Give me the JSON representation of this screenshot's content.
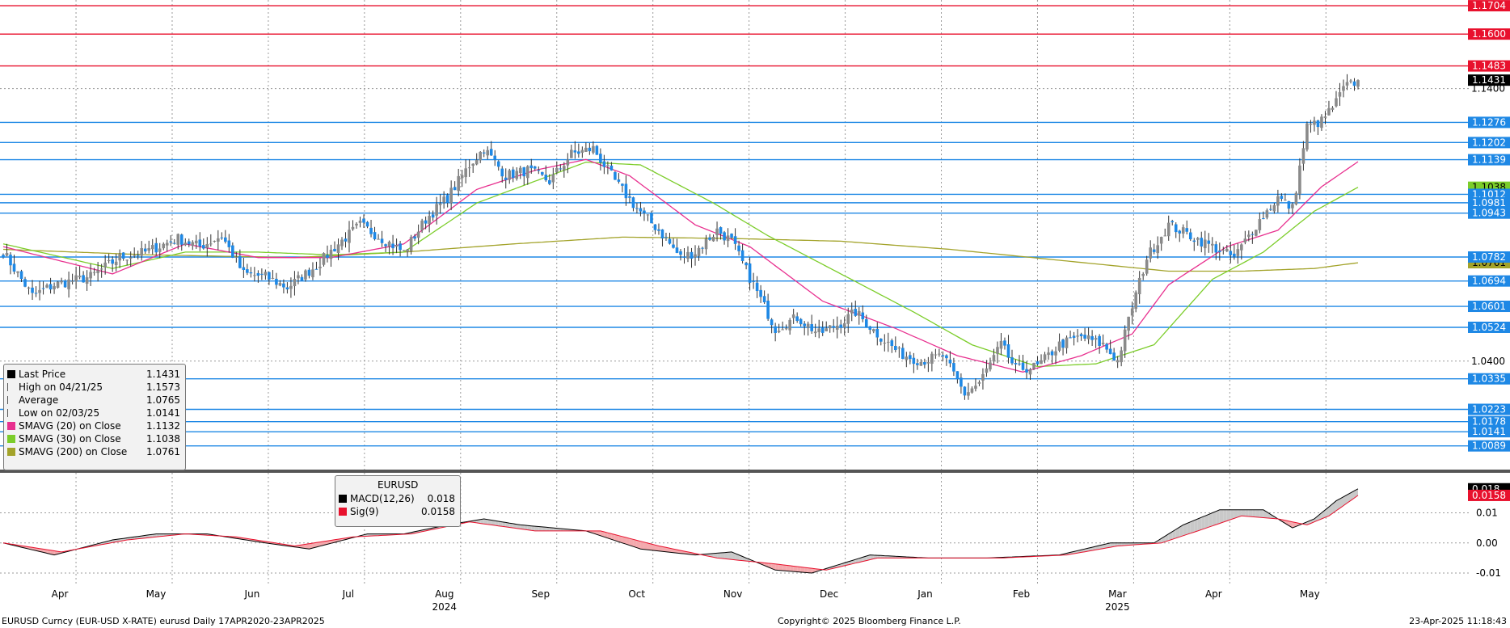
{
  "chart_data": [
    {
      "type": "candlestick",
      "id": "price",
      "ylim": [
        1.0005,
        1.1725
      ],
      "y_ticks": [
        1.04,
        1.14
      ],
      "x_months": [
        "Apr",
        "May",
        "Jun",
        "Jul",
        "Aug",
        "Sep",
        "Oct",
        "Nov",
        "Dec",
        "Jan",
        "Feb",
        "Mar",
        "Apr",
        "May"
      ],
      "year_labels": [
        "2024",
        "2025"
      ],
      "h_lines_red": [
        1.1704,
        1.16,
        1.1483
      ],
      "h_lines_blue": [
        1.1276,
        1.1202,
        1.1139,
        1.1012,
        1.0981,
        1.0943,
        1.0782,
        1.0694,
        1.0601,
        1.0524,
        1.0335,
        1.0223,
        1.0178,
        1.0141,
        1.0089
      ],
      "price_labels": [
        {
          "text": "1.1704",
          "value": 1.1704,
          "bg": "#e8112d"
        },
        {
          "text": "1.1600",
          "value": 1.16,
          "bg": "#e8112d"
        },
        {
          "text": "1.1483",
          "value": 1.1483,
          "bg": "#e8112d"
        },
        {
          "text": "1.1431",
          "value": 1.1431,
          "bg": "#000000"
        },
        {
          "text": "1.1276",
          "value": 1.1276,
          "bg": "#1e88e5"
        },
        {
          "text": "1.1202",
          "value": 1.1202,
          "bg": "#1e88e5"
        },
        {
          "text": "1.1139",
          "value": 1.1139,
          "bg": "#1e88e5"
        },
        {
          "text": "1.1038",
          "value": 1.1038,
          "bg": "#7ccd2a"
        },
        {
          "text": "1.1012",
          "value": 1.1012,
          "bg": "#1e88e5"
        },
        {
          "text": "1.0981",
          "value": 1.0981,
          "bg": "#1e88e5"
        },
        {
          "text": "1.0943",
          "value": 1.0943,
          "bg": "#1e88e5"
        },
        {
          "text": "1.0761",
          "value": 1.0761,
          "bg": "#a3a32a"
        },
        {
          "text": "1.0782",
          "value": 1.0782,
          "bg": "#1e88e5"
        },
        {
          "text": "1.0694",
          "value": 1.0694,
          "bg": "#1e88e5"
        },
        {
          "text": "1.0601",
          "value": 1.0601,
          "bg": "#1e88e5"
        },
        {
          "text": "1.0524",
          "value": 1.0524,
          "bg": "#1e88e5"
        },
        {
          "text": "1.0335",
          "value": 1.0335,
          "bg": "#1e88e5"
        },
        {
          "text": "1.0223",
          "value": 1.0223,
          "bg": "#1e88e5"
        },
        {
          "text": "1.0178",
          "value": 1.0178,
          "bg": "#1e88e5"
        },
        {
          "text": "1.0141",
          "value": 1.0141,
          "bg": "#1e88e5"
        },
        {
          "text": "1.0089",
          "value": 1.0089,
          "bg": "#1e88e5"
        }
      ],
      "close_anchors": [
        [
          0,
          1.08
        ],
        [
          8,
          1.064
        ],
        [
          14,
          1.068
        ],
        [
          24,
          1.071
        ],
        [
          32,
          1.078
        ],
        [
          39,
          1.08
        ],
        [
          48,
          1.085
        ],
        [
          54,
          1.082
        ],
        [
          60,
          1.086
        ],
        [
          66,
          1.072
        ],
        [
          72,
          1.071
        ],
        [
          78,
          1.067
        ],
        [
          86,
          1.075
        ],
        [
          92,
          1.083
        ],
        [
          98,
          1.09
        ],
        [
          104,
          1.085
        ],
        [
          110,
          1.08
        ],
        [
          116,
          1.092
        ],
        [
          122,
          1.1
        ],
        [
          128,
          1.112
        ],
        [
          132,
          1.118
        ],
        [
          138,
          1.108
        ],
        [
          144,
          1.11
        ],
        [
          150,
          1.106
        ],
        [
          156,
          1.116
        ],
        [
          162,
          1.118
        ],
        [
          168,
          1.106
        ],
        [
          174,
          1.096
        ],
        [
          180,
          1.088
        ],
        [
          186,
          1.078
        ],
        [
          190,
          1.08
        ],
        [
          196,
          1.088
        ],
        [
          200,
          1.084
        ],
        [
          206,
          1.068
        ],
        [
          212,
          1.052
        ],
        [
          218,
          1.056
        ],
        [
          224,
          1.05
        ],
        [
          230,
          1.054
        ],
        [
          234,
          1.058
        ],
        [
          240,
          1.05
        ],
        [
          246,
          1.043
        ],
        [
          252,
          1.04
        ],
        [
          258,
          1.042
        ],
        [
          264,
          1.028
        ],
        [
          268,
          1.032
        ],
        [
          274,
          1.046
        ],
        [
          278,
          1.037
        ],
        [
          284,
          1.038
        ],
        [
          290,
          1.046
        ],
        [
          296,
          1.049
        ],
        [
          302,
          1.046
        ],
        [
          306,
          1.04
        ],
        [
          310,
          1.06
        ],
        [
          314,
          1.078
        ],
        [
          320,
          1.09
        ],
        [
          326,
          1.086
        ],
        [
          332,
          1.082
        ],
        [
          338,
          1.078
        ],
        [
          344,
          1.09
        ],
        [
          350,
          1.1
        ],
        [
          354,
          1.096
        ],
        [
          358,
          1.126
        ],
        [
          362,
          1.128
        ],
        [
          366,
          1.135
        ],
        [
          368,
          1.14
        ],
        [
          372,
          1.143
        ]
      ],
      "sma_20": [
        [
          0,
          1.082
        ],
        [
          30,
          1.072
        ],
        [
          50,
          1.083
        ],
        [
          70,
          1.078
        ],
        [
          90,
          1.078
        ],
        [
          110,
          1.083
        ],
        [
          130,
          1.103
        ],
        [
          146,
          1.11
        ],
        [
          160,
          1.114
        ],
        [
          172,
          1.108
        ],
        [
          190,
          1.09
        ],
        [
          205,
          1.082
        ],
        [
          225,
          1.062
        ],
        [
          245,
          1.052
        ],
        [
          262,
          1.042
        ],
        [
          280,
          1.036
        ],
        [
          296,
          1.042
        ],
        [
          310,
          1.05
        ],
        [
          320,
          1.068
        ],
        [
          336,
          1.082
        ],
        [
          350,
          1.088
        ],
        [
          362,
          1.104
        ],
        [
          372,
          1.1132
        ]
      ],
      "sma_30": [
        [
          0,
          1.083
        ],
        [
          30,
          1.074
        ],
        [
          50,
          1.08
        ],
        [
          70,
          1.08
        ],
        [
          90,
          1.079
        ],
        [
          110,
          1.08
        ],
        [
          130,
          1.098
        ],
        [
          146,
          1.106
        ],
        [
          160,
          1.113
        ],
        [
          175,
          1.112
        ],
        [
          195,
          1.098
        ],
        [
          210,
          1.086
        ],
        [
          230,
          1.072
        ],
        [
          250,
          1.058
        ],
        [
          266,
          1.046
        ],
        [
          284,
          1.038
        ],
        [
          300,
          1.039
        ],
        [
          316,
          1.046
        ],
        [
          332,
          1.07
        ],
        [
          346,
          1.08
        ],
        [
          360,
          1.095
        ],
        [
          372,
          1.1038
        ]
      ],
      "sma_200": [
        [
          0,
          1.081
        ],
        [
          40,
          1.079
        ],
        [
          80,
          1.078
        ],
        [
          110,
          1.08
        ],
        [
          140,
          1.083
        ],
        [
          170,
          1.0855
        ],
        [
          200,
          1.085
        ],
        [
          230,
          1.084
        ],
        [
          260,
          1.081
        ],
        [
          290,
          1.077
        ],
        [
          320,
          1.073
        ],
        [
          340,
          1.073
        ],
        [
          360,
          1.074
        ],
        [
          372,
          1.0761
        ]
      ]
    },
    {
      "type": "line",
      "id": "macd",
      "title": "EURUSD",
      "ylim": [
        -0.0135,
        0.0225
      ],
      "y_ticks": [
        0.01,
        0.0,
        -0.01
      ],
      "y_tick_labels": [
        "0.01",
        "0.00",
        "-0.01"
      ],
      "price_labels": [
        {
          "text": "0.018",
          "value": 0.018,
          "bg": "#000000"
        },
        {
          "text": "0.0158",
          "value": 0.0158,
          "bg": "#e8112d"
        }
      ],
      "macd_anchors": [
        [
          0,
          0.0
        ],
        [
          14,
          -0.004
        ],
        [
          30,
          0.001
        ],
        [
          42,
          0.003
        ],
        [
          56,
          0.003
        ],
        [
          72,
          0.0
        ],
        [
          84,
          -0.002
        ],
        [
          100,
          0.003
        ],
        [
          110,
          0.003
        ],
        [
          122,
          0.006
        ],
        [
          132,
          0.008
        ],
        [
          142,
          0.006
        ],
        [
          160,
          0.004
        ],
        [
          175,
          -0.002
        ],
        [
          190,
          -0.004
        ],
        [
          200,
          -0.003
        ],
        [
          212,
          -0.009
        ],
        [
          222,
          -0.01
        ],
        [
          238,
          -0.004
        ],
        [
          254,
          -0.005
        ],
        [
          270,
          -0.005
        ],
        [
          290,
          -0.004
        ],
        [
          304,
          0.0
        ],
        [
          316,
          0.0
        ],
        [
          324,
          0.006
        ],
        [
          334,
          0.011
        ],
        [
          346,
          0.011
        ],
        [
          354,
          0.005
        ],
        [
          360,
          0.008
        ],
        [
          366,
          0.014
        ],
        [
          372,
          0.018
        ]
      ],
      "sig_anchors": [
        [
          0,
          0.0
        ],
        [
          16,
          -0.003
        ],
        [
          34,
          0.001
        ],
        [
          50,
          0.003
        ],
        [
          64,
          0.002
        ],
        [
          80,
          -0.001
        ],
        [
          96,
          0.002
        ],
        [
          112,
          0.003
        ],
        [
          128,
          0.007
        ],
        [
          146,
          0.004
        ],
        [
          164,
          0.004
        ],
        [
          180,
          -0.001
        ],
        [
          196,
          -0.005
        ],
        [
          212,
          -0.007
        ],
        [
          226,
          -0.009
        ],
        [
          240,
          -0.005
        ],
        [
          256,
          -0.005
        ],
        [
          274,
          -0.005
        ],
        [
          292,
          -0.004
        ],
        [
          306,
          -0.001
        ],
        [
          318,
          0.0
        ],
        [
          328,
          0.004
        ],
        [
          340,
          0.009
        ],
        [
          350,
          0.008
        ],
        [
          358,
          0.006
        ],
        [
          364,
          0.009
        ],
        [
          372,
          0.0158
        ]
      ]
    }
  ],
  "legend": {
    "rows": [
      {
        "name": "Last Price",
        "value": "1.1431",
        "color": "#000000"
      },
      {
        "name": "High on 04/21/25",
        "value": "1.1573",
        "color": ""
      },
      {
        "name": "Average",
        "value": "1.0765",
        "color": ""
      },
      {
        "name": "Low on 02/03/25",
        "value": "1.0141",
        "color": ""
      },
      {
        "name": "SMAVG (20)  on Close",
        "value": "1.1132",
        "color": "#e8308f"
      },
      {
        "name": "SMAVG (30)  on Close",
        "value": "1.1038",
        "color": "#7ccd2a"
      },
      {
        "name": "SMAVG (200)  on Close",
        "value": "1.0761",
        "color": "#a3a32a"
      }
    ]
  },
  "macd_legend": {
    "title": "EURUSD",
    "rows": [
      {
        "name": "MACD(12,26)",
        "value": "0.018",
        "color": "#000000"
      },
      {
        "name": "Sig(9)",
        "value": "0.0158",
        "color": "#e8112d"
      }
    ]
  },
  "footer": {
    "left": "EURUSD Curncy (EUR-USD X-RATE) eurusd  Daily 17APR2020-23APR2025",
    "center": "Copyright© 2025 Bloomberg Finance L.P.",
    "right": "23-Apr-2025 11:18:43"
  },
  "colors": {
    "up": "#8a8a8a",
    "down": "#1e88e5",
    "sma20": "#e8308f",
    "sma30": "#7ccd2a",
    "sma200": "#a3a32a",
    "red_line": "#e8112d",
    "blue_line": "#1e88e5",
    "macd": "#000000",
    "sig": "#e8112d",
    "fill_up": "#c9c9c9",
    "fill_down": "#f4a9ad"
  }
}
